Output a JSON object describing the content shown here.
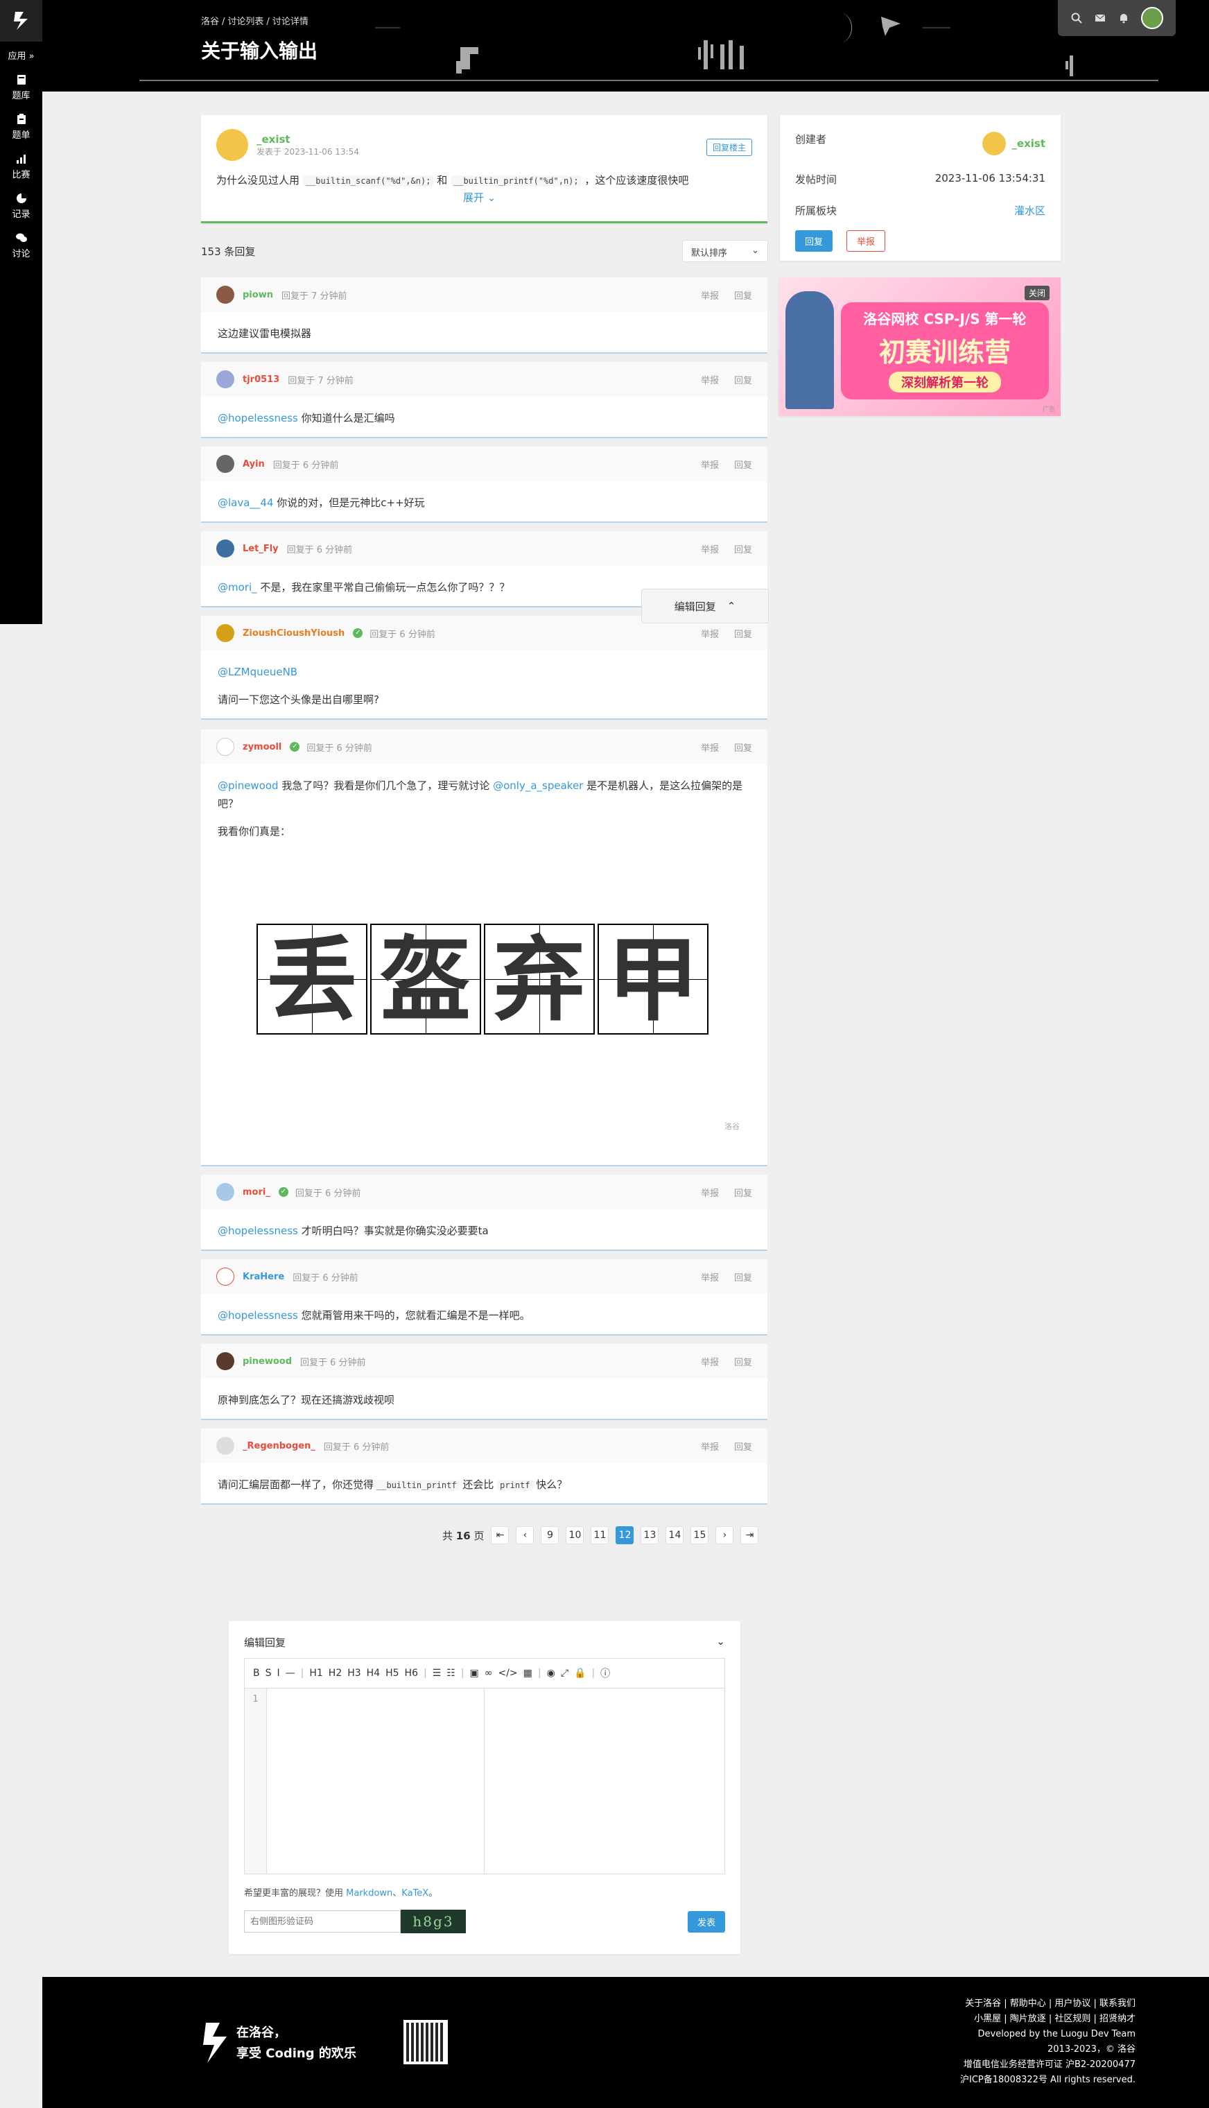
{
  "sidebar": {
    "app_label": "应用 »",
    "items": [
      {
        "label": "题库",
        "icon": "book-icon"
      },
      {
        "label": "题单",
        "icon": "clipboard-icon"
      },
      {
        "label": "比赛",
        "icon": "bar-chart-icon"
      },
      {
        "label": "记录",
        "icon": "pie-chart-icon"
      },
      {
        "label": "讨论",
        "icon": "comments-icon"
      }
    ]
  },
  "header": {
    "breadcrumb": [
      "洛谷",
      "讨论列表",
      "讨论详情"
    ],
    "title": "关于输入输出"
  },
  "post": {
    "author": "_exist",
    "date_label": "发表于 2023-11-06 13:54",
    "reply_owner_label": "回复楼主",
    "text_prefix": "为什么没见过人用",
    "code1": "__builtin_scanf(\"%d\",&n);",
    "text_mid": "和",
    "code2": "__builtin_printf(\"%d\",n);",
    "text_suffix": "，这个应该速度很快吧",
    "expand_label": "展开"
  },
  "info": {
    "creator_label": "创建者",
    "creator": "_exist",
    "time_label": "发帖时间",
    "time": "2023-11-06 13:54:31",
    "board_label": "所属板块",
    "board": "灌水区",
    "reply_btn": "回复",
    "report_btn": "举报"
  },
  "ad": {
    "close": "关闭",
    "line1": "洛谷网校 CSP-J/S 第一轮",
    "line2": "初赛训练营",
    "line3": "深刻解析第一轮",
    "small": "广告"
  },
  "reply_count": "153 条回复",
  "sort_label": "默认排序",
  "actions": {
    "report": "举报",
    "reply": "回复"
  },
  "replies": [
    {
      "name": "piown",
      "name_color": "#5eb95e",
      "time": "回复于 7 分钟前",
      "mention": "",
      "text": "这边建议雷电模拟器"
    },
    {
      "name": "tjr0513",
      "name_color": "#e74c3c",
      "time": "回复于 7 分钟前",
      "mention": "@hopelessness",
      "text": " 你知道什么是汇编吗"
    },
    {
      "name": "Ayin",
      "name_color": "#e74c3c",
      "time": "回复于 6 分钟前",
      "mention": "@lava__44",
      "text": " 你说的对，但是元神比c++好玩"
    },
    {
      "name": "Let_Fly",
      "name_color": "#e74c3c",
      "time": "回复于 6 分钟前",
      "mention": "@mori_",
      "text": " 不是，我在家里平常自己偷偷玩一点怎么你了吗？？？"
    },
    {
      "name": "ZioushCioushYioush",
      "name_color": "#e67e22",
      "time": "回复于 6 分钟前",
      "mention": "@LZMqueueNB",
      "text": "请问一下您这个头像是出自哪里啊?"
    },
    {
      "name": "zymooll",
      "name_color": "#e74c3c",
      "time": "回复于 6 分钟前",
      "mention": "@pinewood",
      "text": " 我急了吗？我看是你们几个急了，理亏就讨论 ",
      "mention2": "@only_a_speaker",
      "text2": " 是不是机器人，是这么拉偏架的是吧？",
      "text3": "我看你们真是：",
      "image_chars": [
        "丢",
        "盔",
        "弃",
        "甲"
      ],
      "watermark": "洛谷"
    },
    {
      "name": "mori_",
      "name_color": "#e74c3c",
      "time": "回复于 6 分钟前",
      "mention": "@hopelessness",
      "text": " 才听明白吗？事实就是你确实没必要要ta"
    },
    {
      "name": "KraHere",
      "name_color": "#3498db",
      "time": "回复于 6 分钟前",
      "mention": "@hopelessness",
      "text": " 您就甭管用来干吗的，您就看汇编是不是一样吧。"
    },
    {
      "name": "pinewood",
      "name_color": "#5eb95e",
      "time": "回复于 6 分钟前",
      "mention": "",
      "text": "原神到底怎么了？现在还搞游戏歧视呗"
    },
    {
      "name": "_Regenbogen_",
      "name_color": "#e74c3c",
      "time": "回复于 6 分钟前",
      "mention": "",
      "text": "请问汇编层面都一样了，你还觉得",
      "code1": "__builtin_printf",
      "text_b": " 还会比 ",
      "code2": "printf",
      "text_c": " 快么？"
    }
  ],
  "float_edit_label": "编辑回复",
  "pager": {
    "total_prefix": "共",
    "total": "16",
    "total_suffix": "页",
    "pages": [
      "9",
      "10",
      "11",
      "12",
      "13",
      "14",
      "15"
    ],
    "current": "12"
  },
  "editor": {
    "title": "编辑回复",
    "toolbar": [
      "B",
      "S",
      "I",
      "—",
      "|",
      "H1",
      "H2",
      "H3",
      "H4",
      "H5",
      "H6",
      "|",
      "☰",
      "☷",
      "|",
      "▣",
      "∞",
      "</>",
      "▦",
      "|",
      "◉",
      "⤢",
      "🔒",
      "|",
      "ⓘ"
    ],
    "line_no": "1",
    "hint_prefix": "希望更丰富的展现？使用 ",
    "hint_md": "Markdown",
    "hint_sep": "、",
    "hint_katex": "KaTeX",
    "hint_suffix": "。",
    "captcha_placeholder": "右侧图形验证码",
    "captcha_text": "h8g3",
    "submit": "发表"
  },
  "footer": {
    "slogan1": "在洛谷，",
    "slogan2": "享受 Coding 的欢乐",
    "links1": "关于洛谷 | 帮助中心 | 用户协议 | 联系我们",
    "links2": "小黑屋 | 陶片放逐 | 社区规则 | 招贤纳才",
    "dev": "Developed by the Luogu Dev Team",
    "copy": "2013-2023，© 洛谷",
    "icp1": "增值电信业务经营许可证 沪B2-20200477",
    "icp2": "沪ICP备18008322号 All rights reserved."
  }
}
